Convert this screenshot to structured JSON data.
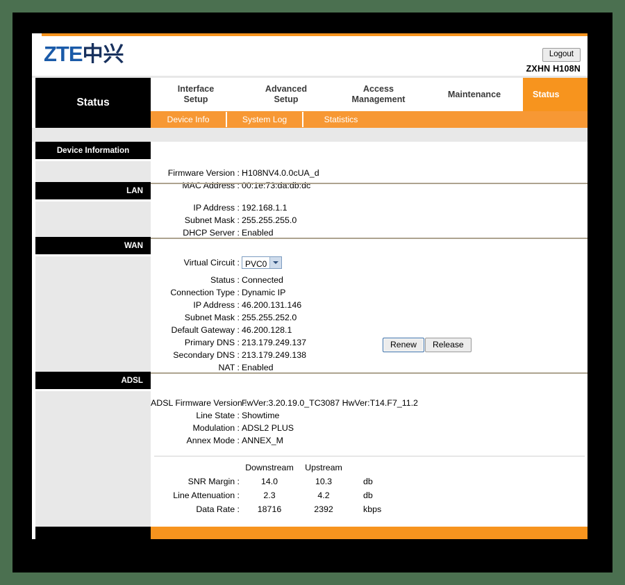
{
  "window": {
    "outer_background": "#4b7050",
    "frame_background": "#000000",
    "accent_orange": "#f7941e",
    "header_rule_color": "#e8e8e8",
    "divider_color": "#ada38f"
  },
  "header": {
    "logo_latin": "ZTE",
    "logo_cjk": "中兴",
    "logout_label": "Logout",
    "model_name": "ZXHN H108N"
  },
  "nav": {
    "section_title": "Status",
    "tabs": [
      {
        "label": "Interface\nSetup",
        "line1": "Interface",
        "line2": "Setup",
        "active": false
      },
      {
        "label": "Advanced\nSetup",
        "line1": "Advanced",
        "line2": "Setup",
        "active": false
      },
      {
        "label": "Access\nManagement",
        "line1": "Access",
        "line2": "Management",
        "active": false
      },
      {
        "label": "Maintenance",
        "line1": "Maintenance",
        "line2": "",
        "active": false
      },
      {
        "label": "Status",
        "line1": "Status",
        "line2": "",
        "active": true
      }
    ],
    "subtabs": [
      {
        "label": "Device Info",
        "active": true
      },
      {
        "label": "System Log",
        "active": false
      },
      {
        "label": "Statistics",
        "active": false
      }
    ]
  },
  "rail": {
    "device_information": "Device Information",
    "lan": "LAN",
    "wan": "WAN",
    "adsl": "ADSL"
  },
  "device_information": {
    "rows": [
      {
        "label": "Firmware Version :",
        "value": "H108NV4.0.0cUA_d"
      },
      {
        "label": "MAC Address :",
        "value": "00:1e:73:da:db:dc"
      }
    ]
  },
  "lan": {
    "rows": [
      {
        "label": "IP Address :",
        "value": "192.168.1.1"
      },
      {
        "label": "Subnet Mask :",
        "value": "255.255.255.0"
      },
      {
        "label": "DHCP Server :",
        "value": "Enabled"
      }
    ]
  },
  "wan": {
    "virtual_circuit_label": "Virtual Circuit :",
    "virtual_circuit_value": "PVC0",
    "rows": [
      {
        "label": "Status :",
        "value": "Connected"
      },
      {
        "label": "Connection Type :",
        "value": "Dynamic IP"
      },
      {
        "label": "IP Address :",
        "value": "46.200.131.146"
      },
      {
        "label": "Subnet Mask :",
        "value": "255.255.252.0"
      },
      {
        "label": "Default Gateway :",
        "value": "46.200.128.1"
      },
      {
        "label": "Primary DNS :",
        "value": "213.179.249.137"
      },
      {
        "label": "Secondary DNS :",
        "value": "213.179.249.138"
      },
      {
        "label": "NAT :",
        "value": "Enabled"
      }
    ],
    "renew_label": "Renew",
    "release_label": "Release"
  },
  "adsl": {
    "rows": [
      {
        "label": "ADSL Firmware Version :",
        "value": "FwVer:3.20.19.0_TC3087 HwVer:T14.F7_11.2"
      },
      {
        "label": "Line State :",
        "value": "Showtime"
      },
      {
        "label": "Modulation :",
        "value": "ADSL2 PLUS"
      },
      {
        "label": "Annex Mode :",
        "value": "ANNEX_M"
      }
    ],
    "stats": {
      "col_downstream": "Downstream",
      "col_upstream": "Upstream",
      "rows": [
        {
          "label": "SNR Margin :",
          "downstream": "14.0",
          "upstream": "10.3",
          "unit": "db"
        },
        {
          "label": "Line Attenuation :",
          "downstream": "2.3",
          "upstream": "4.2",
          "unit": "db"
        },
        {
          "label": "Data Rate :",
          "downstream": "18716",
          "upstream": "2392",
          "unit": "kbps"
        }
      ]
    }
  }
}
